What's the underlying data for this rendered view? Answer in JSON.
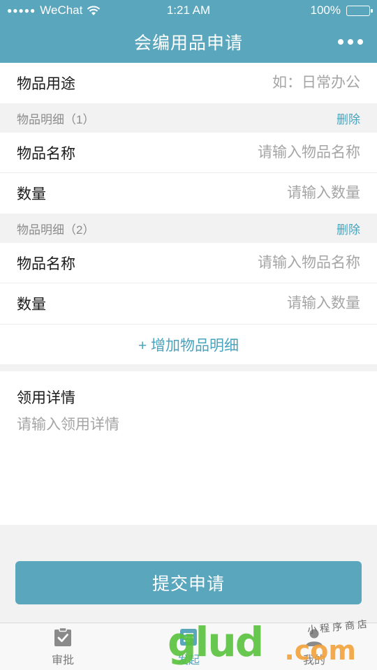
{
  "status_bar": {
    "carrier": "WeChat",
    "time": "1:21 AM",
    "battery": "100%"
  },
  "nav": {
    "title": "会编用品申请"
  },
  "form": {
    "purpose": {
      "label": "物品用途",
      "placeholder": "如：日常办公"
    },
    "items": [
      {
        "header": "物品明细（1）",
        "delete_label": "删除",
        "name_label": "物品名称",
        "name_placeholder": "请输入物品名称",
        "qty_label": "数量",
        "qty_placeholder": "请输入数量"
      },
      {
        "header": "物品明细（2）",
        "delete_label": "删除",
        "name_label": "物品名称",
        "name_placeholder": "请输入物品名称",
        "qty_label": "数量",
        "qty_placeholder": "请输入数量"
      }
    ],
    "add_label": "+ 增加物品明细",
    "detail": {
      "label": "领用详情",
      "placeholder": "请输入领用详情"
    },
    "submit_label": "提交申请"
  },
  "tabbar": {
    "tabs": [
      {
        "label": "审批",
        "icon": "clipboard-check-icon",
        "active": false
      },
      {
        "label": "发起",
        "icon": "form-list-icon",
        "active": true
      },
      {
        "label": "我的",
        "icon": "user-icon",
        "active": false
      }
    ]
  },
  "watermark": {
    "brand": "glud",
    "suffix": ".com",
    "small": "小程序商店"
  },
  "colors": {
    "accent": "#5aa6bd",
    "link": "#4aa3bd",
    "background": "#f2f2f2"
  }
}
